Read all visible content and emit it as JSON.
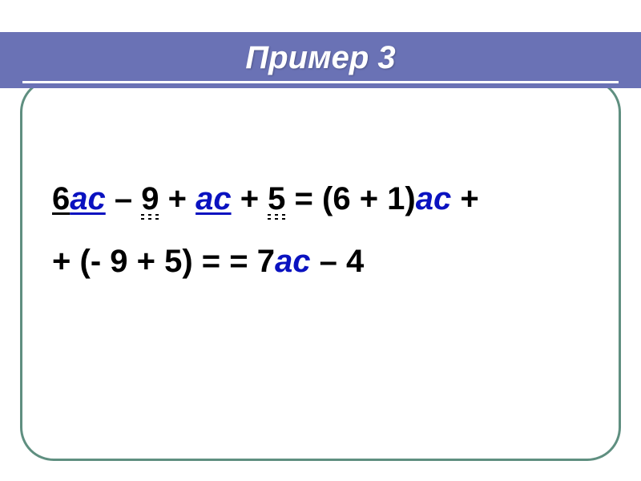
{
  "slide": {
    "title": "Пример 3",
    "expr": {
      "p1_coef": "6",
      "p1_var": "ас",
      "p1_op1": " – ",
      "p1_n1": "9",
      "p1_op2": " + ",
      "p1_var2": "ас",
      "p1_op3": " + ",
      "p1_n2": "5",
      "eq_open": " = (",
      "p2a": "6 + 1",
      "p2_close": ")",
      "p2_var": "ас",
      "p2_plus_trail": " +",
      "line2_lead": "+ ",
      "p3_open": "(",
      "p3_inner": "- 9 + 5",
      "p3_close": ")",
      "eq2": " = = ",
      "res_coef": "7",
      "res_var": "ас",
      "res_tail": " – 4"
    }
  },
  "colors": {
    "accent_bar": "#6a72b5",
    "frame": "#5f8f80",
    "variable": "#0a12c0"
  }
}
